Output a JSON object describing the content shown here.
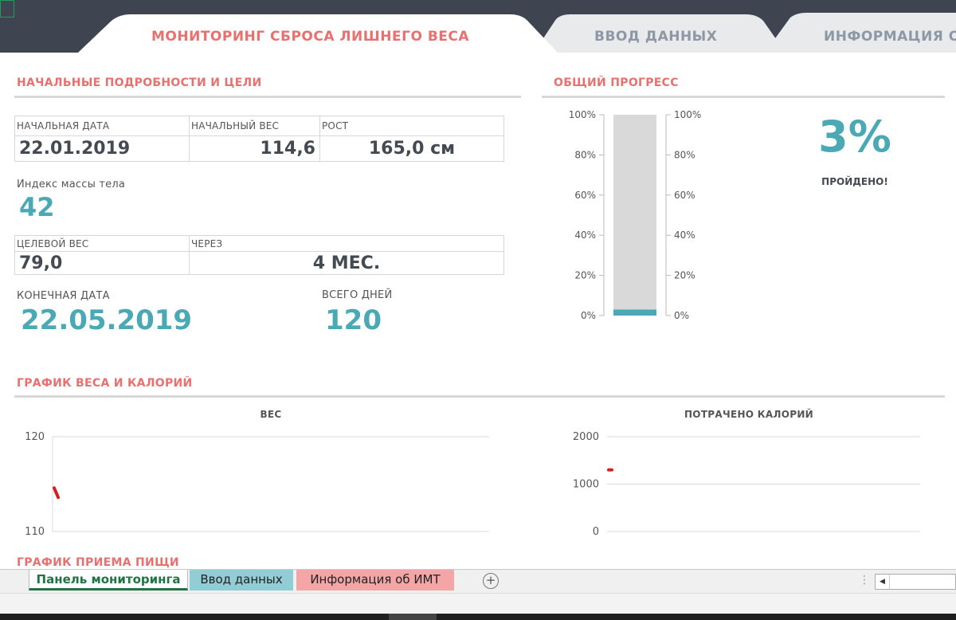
{
  "tabs": [
    {
      "label": "МОНИТОРИНГ СБРОСА ЛИШНЕГО ВЕСА",
      "active": true
    },
    {
      "label": "ВВОД ДАННЫХ",
      "active": false
    },
    {
      "label": "ИНФОРМАЦИЯ О",
      "active": false
    }
  ],
  "details": {
    "section_title": "НАЧАЛЬНЫЕ ПОДРОБНОСТИ И ЦЕЛИ",
    "start_date_label": "НАЧАЛЬНАЯ ДАТА",
    "start_date": "22.01.2019",
    "start_weight_label": "НАЧАЛЬНЫЙ ВЕС",
    "start_weight": "114,6",
    "height_label": "РОСТ",
    "height": "165,0 см",
    "bmi_label": "Индекс массы тела",
    "bmi": "42",
    "target_weight_label": "ЦЕЛЕВОЙ ВЕС",
    "target_weight": "79,0",
    "through_label": "ЧЕРЕЗ",
    "through": "4 МЕС.",
    "end_date_label": "КОНЕЧНАЯ ДАТА",
    "end_date": "22.05.2019",
    "total_days_label": "ВСЕГО ДНЕЙ",
    "total_days": "120"
  },
  "progress": {
    "section_title": "ОБЩИЙ ПРОГРЕСС",
    "percent_text": "3%",
    "done_label": "ПРОЙДЕНО!",
    "value": 0.03,
    "ticks": [
      "100%",
      "80%",
      "60%",
      "40%",
      "20%",
      "0%"
    ],
    "bar_color": "#4aa9b4",
    "track_color": "#d9d9d9"
  },
  "charts": {
    "section_title": "ГРАФИК ВЕСА И КАЛОРИЙ",
    "food_section_title": "ГРАФИК ПРИЕМА ПИЩИ"
  },
  "chart_data": [
    {
      "type": "line",
      "title": "ВЕС",
      "ylim": [
        110,
        120
      ],
      "yticks": [
        "120",
        "110"
      ],
      "grid": true,
      "series": [
        {
          "values": [
            114.6,
            113.6
          ],
          "color": "#d62020"
        }
      ]
    },
    {
      "type": "line",
      "title": "ПОТРАЧЕНО КАЛОРИЙ",
      "ylim": [
        0,
        2000
      ],
      "yticks": [
        "2000",
        "1000",
        "0"
      ],
      "grid": true,
      "series": [
        {
          "values": [
            1300,
            1300
          ],
          "color": "#d62020"
        }
      ]
    }
  ],
  "sheets": [
    {
      "label": "Панель мониторинга",
      "active": true,
      "color": "#ffffff"
    },
    {
      "label": "Ввод данных",
      "active": false,
      "color": "#92cdd5"
    },
    {
      "label": "Информация об ИМТ",
      "active": false,
      "color": "#f4a6a6"
    }
  ],
  "sheet_add_label": "+",
  "scroll_left_label": "◀",
  "more_label": "⋮"
}
